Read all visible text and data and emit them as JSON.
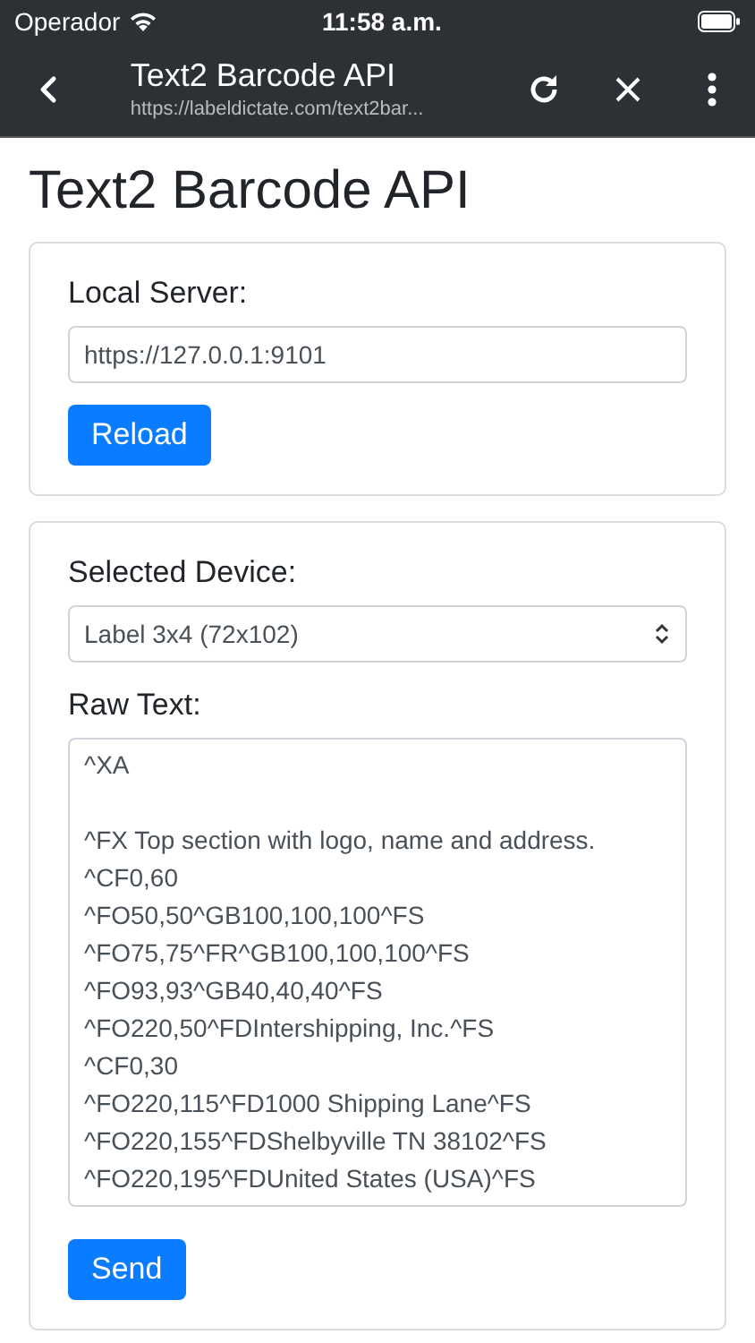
{
  "status_bar": {
    "carrier": "Operador",
    "time": "11:58 a.m."
  },
  "browser_bar": {
    "title": "Text2 Barcode API",
    "url": "https://labeldictate.com/text2bar..."
  },
  "page": {
    "heading": "Text2 Barcode API"
  },
  "server_card": {
    "label": "Local Server:",
    "value": "https://127.0.0.1:9101",
    "button": "Reload"
  },
  "device_card": {
    "device_label": "Selected Device:",
    "device_value": "Label 3x4 (72x102)",
    "raw_label": "Raw Text:",
    "raw_text": "^XA\n\n^FX Top section with logo, name and address.\n^CF0,60\n^FO50,50^GB100,100,100^FS\n^FO75,75^FR^GB100,100,100^FS\n^FO93,93^GB40,40,40^FS\n^FO220,50^FDIntershipping, Inc.^FS\n^CF0,30\n^FO220,115^FD1000 Shipping Lane^FS\n^FO220,155^FDShelbyville TN 38102^FS\n^FO220,195^FDUnited States (USA)^FS",
    "button": "Send"
  }
}
